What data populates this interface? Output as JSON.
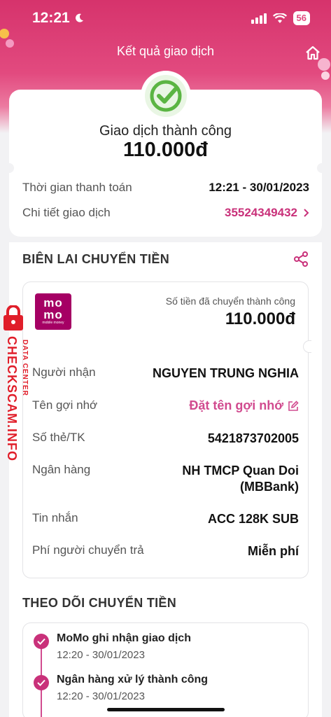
{
  "status_bar": {
    "time": "12:21",
    "battery": "56"
  },
  "header": {
    "title": "Kết quả giao dịch"
  },
  "summary": {
    "status": "Giao dịch thành công",
    "amount": "110.000đ",
    "rows": [
      {
        "label": "Thời gian thanh toán",
        "value": "12:21 - 30/01/2023"
      },
      {
        "label": "Chi tiết giao dịch",
        "value": "35524349432"
      }
    ]
  },
  "receipt": {
    "section_title": "BIÊN LAI CHUYỂN TIỀN",
    "logo_top": "mo\nmo",
    "logo_sub": "mobile money",
    "sent_label": "Số tiền đã chuyển thành công",
    "sent_amount": "110.000đ",
    "recipient_label": "Người nhận",
    "recipient_value": "NGUYEN TRUNG NGHIA",
    "nickname_label": "Tên gợi nhớ",
    "nickname_value": "Đặt tên gợi nhớ",
    "account_label": "Số thẻ/TK",
    "account_value": "5421873702005",
    "bank_label": "Ngân hàng",
    "bank_value_1": "NH TMCP Quan Doi",
    "bank_value_2": "(MBBank)",
    "message_label": "Tin nhắn",
    "message_value": "ACC 128K SUB",
    "fee_label": "Phí người chuyển trả",
    "fee_value": "Miễn phí"
  },
  "tracking": {
    "section_title": "THEO DÕI CHUYỂN TIỀN",
    "steps": [
      {
        "title": "MoMo ghi nhận giao dịch",
        "time": "12:20 - 30/01/2023"
      },
      {
        "title": "Ngân hàng xử lý thành công",
        "time": "12:20 - 30/01/2023"
      }
    ]
  },
  "watermark": {
    "main": "CHECKSCAM.INFO",
    "sub": "DATA CENTER"
  },
  "colors": {
    "brand": "#c9317a",
    "header": "#e24a7f",
    "success": "#5bb543",
    "watermark": "#e01e2a"
  }
}
